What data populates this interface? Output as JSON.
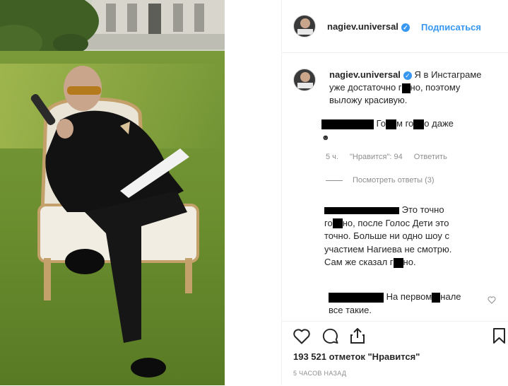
{
  "post": {
    "username": "nagiev.universal",
    "follow_label": "Подписаться",
    "verified_mark": "✓",
    "caption": "Я в Инстаграме уже достаточно г   но, поэтому выложу красивую.",
    "caption_part1": "Я в Инстаграме",
    "caption_part2": "уже достаточно г",
    "caption_part3": "но, поэтому",
    "caption_part4": "выложу красивую."
  },
  "comments": [
    {
      "text_a": "Го",
      "text_b": "м го",
      "text_c": "о даже",
      "emoji": "☻",
      "time": "5 ч.",
      "likes": "\"Нравится\": 94",
      "reply": "Ответить",
      "view_replies": "Посмотреть ответы (3)"
    },
    {
      "line1_tail": "Это точно",
      "line2_a": "го",
      "line2_b": "но, после Голос Дети это",
      "line3": "точно. Больше ни одно шоу с",
      "line4": "участием Нагиева не смотрю.",
      "line5_a": "Сам же сказал г",
      "line5_b": "но."
    },
    {
      "text_a": "На первом",
      "text_b": "нале",
      "line2": "все такие."
    }
  ],
  "footer": {
    "likes": "193 521 отметок \"Нравится\"",
    "time": "5 ЧАСОВ НАЗАД"
  },
  "icons": [
    "heart-icon",
    "comment-icon",
    "share-icon",
    "bookmark-icon",
    "verified-icon"
  ],
  "colors": {
    "link": "#3897f0",
    "muted": "#8e8e8e",
    "verified": "#3897f0"
  }
}
